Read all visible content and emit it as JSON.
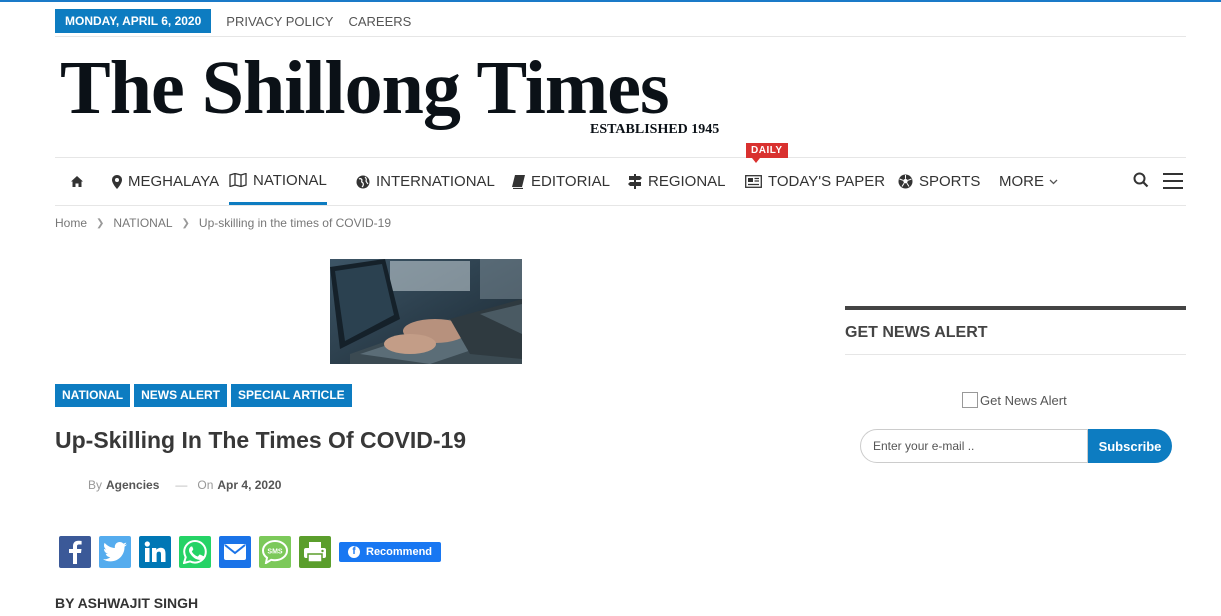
{
  "topbar": {
    "date": "MONDAY, APRIL 6, 2020",
    "links": [
      "PRIVACY POLICY",
      "CAREERS"
    ]
  },
  "logo": {
    "title": "The Shillong Times",
    "established": "ESTABLISHED 1945"
  },
  "nav": {
    "items": [
      {
        "label": "MEGHALAYA",
        "icon": "map-pin-icon"
      },
      {
        "label": "NATIONAL",
        "icon": "map-icon"
      },
      {
        "label": "INTERNATIONAL",
        "icon": "globe-icon"
      },
      {
        "label": "EDITORIAL",
        "icon": "book-icon"
      },
      {
        "label": "REGIONAL",
        "icon": "signpost-icon"
      },
      {
        "label": "TODAY'S PAPER",
        "icon": "newspaper-icon"
      },
      {
        "label": "SPORTS",
        "icon": "soccer-ball-icon"
      },
      {
        "label": "MORE",
        "icon": "chevron-down-icon"
      }
    ],
    "active": "NATIONAL",
    "daily_badge": "DAILY"
  },
  "breadcrumb": [
    "Home",
    "NATIONAL",
    "Up-skilling in the times of COVID-19"
  ],
  "article": {
    "categories": [
      "NATIONAL",
      "NEWS ALERT",
      "SPECIAL ARTICLE"
    ],
    "title": "Up-Skilling In The Times Of COVID-19",
    "by_label": "By",
    "author": "Agencies",
    "on_label": "On",
    "date": "Apr 4, 2020",
    "recommend_label": "Recommend",
    "byline": "BY ASHWAJIT SINGH"
  },
  "share_buttons": [
    {
      "name": "facebook-icon",
      "color": "#3b5998"
    },
    {
      "name": "twitter-icon",
      "color": "#55acee"
    },
    {
      "name": "linkedin-icon",
      "color": "#0077b5"
    },
    {
      "name": "whatsapp-icon",
      "color": "#25d366"
    },
    {
      "name": "email-icon",
      "color": "#1a73e8"
    },
    {
      "name": "sms-icon",
      "color": "#7cc95a"
    },
    {
      "name": "print-icon",
      "color": "#5b9e2c"
    }
  ],
  "sidebar": {
    "widget_title": "GET NEWS ALERT",
    "checkbox_label": "Get News Alert",
    "email_placeholder": "Enter your e-mail ..",
    "subscribe_label": "Subscribe"
  },
  "colors": {
    "accent": "#0d7cc1",
    "daily": "#d9312f"
  }
}
